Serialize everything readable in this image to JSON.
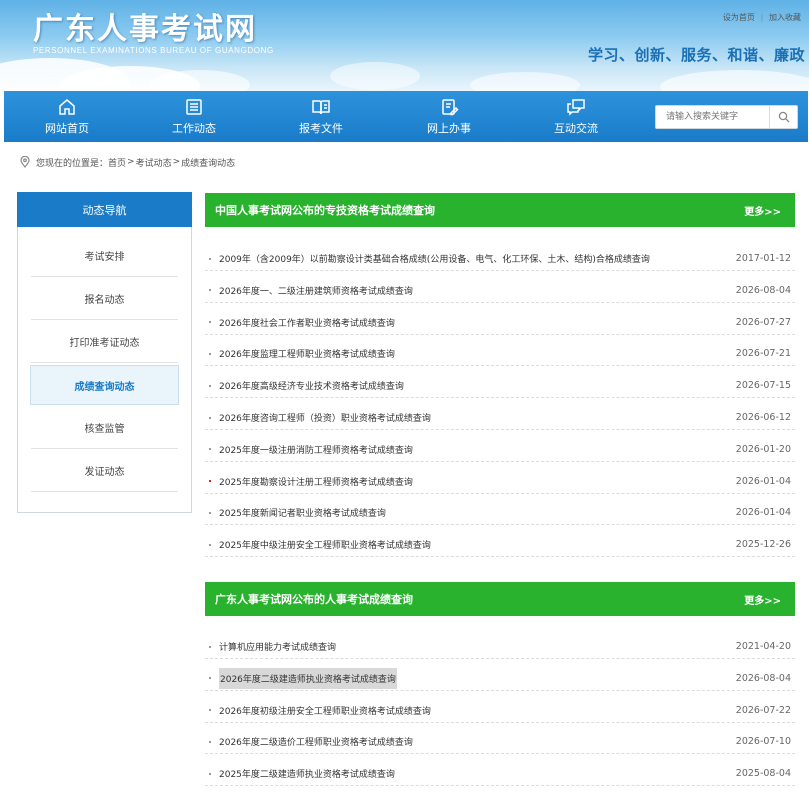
{
  "header": {
    "site_title": "广东人事考试网",
    "site_subtitle": "PERSONNEL EXAMINATIONS BUREAU OF GUANGDONG",
    "top_links": [
      "设为首页",
      "加入收藏"
    ],
    "slogan": "学习、创新、服务、和谐、廉政"
  },
  "nav": {
    "items": [
      {
        "label": "网站首页",
        "icon": "home-icon"
      },
      {
        "label": "工作动态",
        "icon": "list-icon"
      },
      {
        "label": "报考文件",
        "icon": "book-icon"
      },
      {
        "label": "网上办事",
        "icon": "clipboard-edit-icon"
      },
      {
        "label": "互动交流",
        "icon": "chat-bubbles-icon"
      }
    ],
    "search_placeholder": "请输入搜索关键字"
  },
  "breadcrumb": {
    "prefix": "您现在的位置是：",
    "items": [
      "首页",
      "考试动态",
      "成绩查询动态"
    ]
  },
  "sidebar": {
    "title": "动态导航",
    "items": [
      "考试安排",
      "报名动态",
      "打印准考证动态",
      "成绩查询动态",
      "核查监管",
      "发证动态"
    ],
    "active_index": 3
  },
  "panels": [
    {
      "title": "中国人事考试网公布的专技资格考试成绩查询",
      "more": "更多>>",
      "rows": [
        {
          "title": "2009年（含2009年）以前勘察设计类基础合格成绩(公用设备、电气、化工环保、土木、结构)合格成绩查询",
          "date": "2017-01-12"
        },
        {
          "title": "2026年度一、二级注册建筑师资格考试成绩查询",
          "date": "2026-08-04"
        },
        {
          "title": "2026年度社会工作者职业资格考试成绩查询",
          "date": "2026-07-27"
        },
        {
          "title": "2026年度监理工程师职业资格考试成绩查询",
          "date": "2026-07-21"
        },
        {
          "title": "2026年度高级经济专业技术资格考试成绩查询",
          "date": "2026-07-15"
        },
        {
          "title": "2026年度咨询工程师（投资）职业资格考试成绩查询",
          "date": "2026-06-12"
        },
        {
          "title": "2025年度一级注册消防工程师资格考试成绩查询",
          "date": "2026-01-20"
        },
        {
          "title": "2025年度勘察设计注册工程师资格考试成绩查询",
          "date": "2026-01-04"
        },
        {
          "title": "2025年度新闻记者职业资格考试成绩查询",
          "date": "2026-01-04"
        },
        {
          "title": "2025年度中级注册安全工程师职业资格考试成绩查询",
          "date": "2025-12-26"
        }
      ]
    },
    {
      "title": "广东人事考试网公布的人事考试成绩查询",
      "more": "更多>>",
      "rows": [
        {
          "title": "计算机应用能力考试成绩查询",
          "date": "2021-04-20"
        },
        {
          "title": "2026年度二级建造师执业资格考试成绩查询",
          "date": "2026-08-04"
        },
        {
          "title": "2026年度初级注册安全工程师职业资格考试成绩查询",
          "date": "2026-07-22"
        },
        {
          "title": "2026年度二级造价工程师职业资格考试成绩查询",
          "date": "2026-07-10"
        },
        {
          "title": "2025年度二级建造师执业资格考试成绩查询",
          "date": "2025-08-04"
        }
      ]
    }
  ],
  "colors": {
    "nav_blue": "#1a7cc9",
    "panel_green": "#29b22d",
    "slogan_blue": "#1b6fb5"
  }
}
